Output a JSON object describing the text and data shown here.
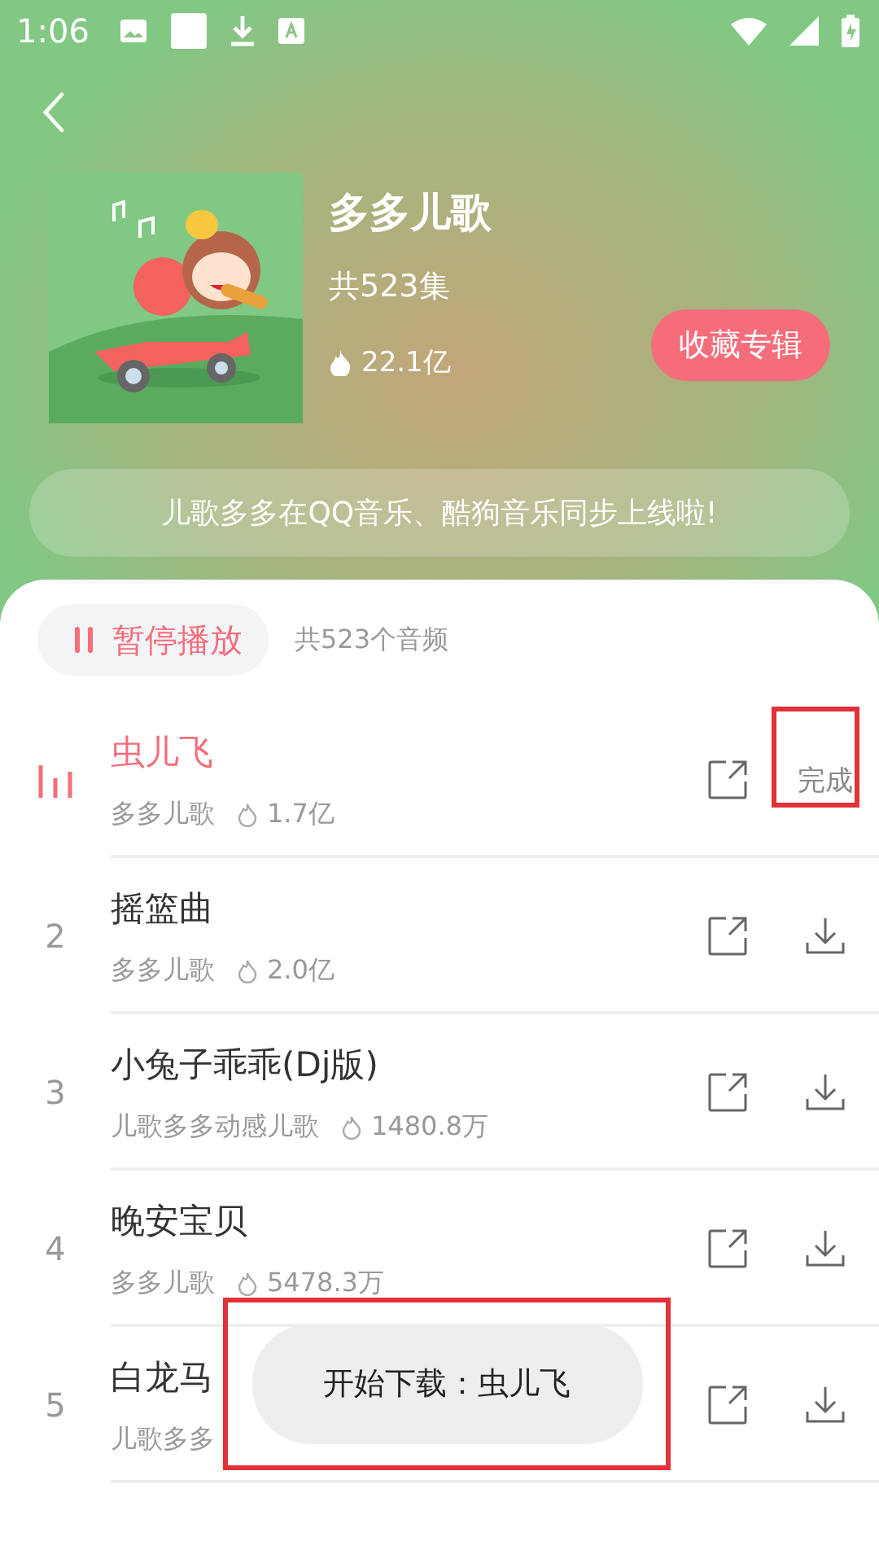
{
  "status_bar": {
    "time": "1:06"
  },
  "album": {
    "title": "多多儿歌",
    "episodes": "共523集",
    "plays": "22.1亿",
    "collect_button": "收藏专辑"
  },
  "notice": "儿歌多多在QQ音乐、酷狗音乐同步上线啦!",
  "player": {
    "pause_button": "暂停播放",
    "total": "共523个音频"
  },
  "tracks": [
    {
      "title": "虫儿飞",
      "artist": "多多儿歌",
      "plays": "1.7亿",
      "selected": true,
      "action": {
        "kind": "status",
        "text": "完成",
        "highlighted": true
      }
    },
    {
      "number": "2",
      "title": "摇篮曲",
      "artist": "多多儿歌",
      "plays": "2.0亿",
      "selected": false,
      "action": {
        "kind": "download"
      }
    },
    {
      "number": "3",
      "title": "小兔子乖乖(Dj版)",
      "artist": "儿歌多多动感儿歌",
      "plays": "1480.8万",
      "selected": false,
      "action": {
        "kind": "download"
      }
    },
    {
      "number": "4",
      "title": "晚安宝贝",
      "artist": "多多儿歌",
      "plays": "5478.3万",
      "selected": false,
      "action": {
        "kind": "download"
      }
    },
    {
      "number": "5",
      "title": "白龙马",
      "artist": "儿歌多多",
      "selected": false,
      "action": {
        "kind": "download"
      }
    }
  ],
  "toast": {
    "text": "开始下载：虫儿飞",
    "highlighted": true
  }
}
